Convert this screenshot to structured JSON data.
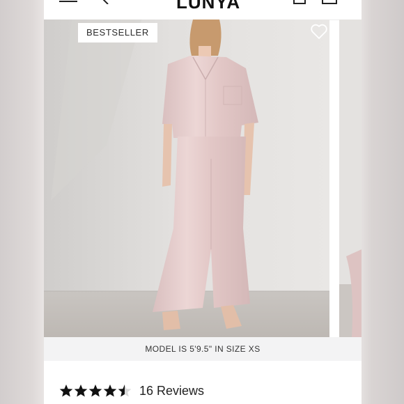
{
  "header": {
    "logo": "LUNYA",
    "icons": [
      "menu-icon",
      "back-icon",
      "account-icon",
      "bag-icon"
    ]
  },
  "gallery": {
    "badge": "BESTSELLER",
    "favorite_icon": "heart-icon",
    "caption": "MODEL IS 5'9.5\" IN SIZE XS"
  },
  "reviews": {
    "rating": 4.5,
    "max_rating": 5,
    "count_label": "16 Reviews"
  },
  "colors": {
    "garment_pink": "#e7cfcf",
    "wall": "#dcdad8",
    "floor": "#c6c1bc",
    "star": "#111111"
  }
}
